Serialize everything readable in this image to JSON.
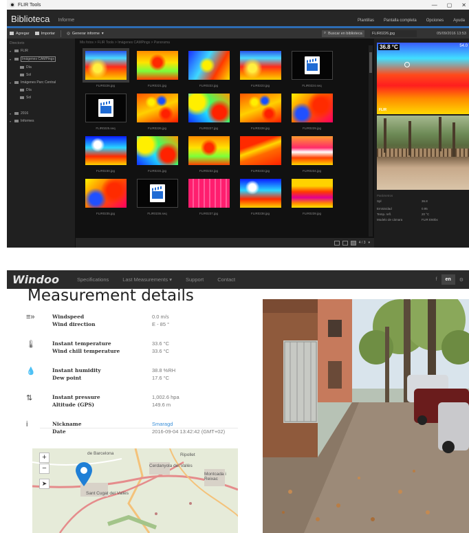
{
  "flir": {
    "window_title": "FLIR Tools",
    "header": {
      "title": "Biblioteca",
      "tab": "Informe",
      "menu": [
        "Plantillas",
        "Pantalla completa",
        "Opciones",
        "Ayuda"
      ]
    },
    "toolbar": {
      "add": "Agregar",
      "import": "Importar",
      "generate": "Generar informe",
      "search_placeholder": "Buscar en biblioteca",
      "filename": "FLIR0226.jpg",
      "filedate": "05/09/2016 13:53"
    },
    "sidebar": {
      "header": "Directorio",
      "items": [
        {
          "label": "FLIR",
          "level": 1
        },
        {
          "label": "Imágenes CAMPings",
          "level": 1,
          "selected": true
        },
        {
          "label": "Día",
          "level": 2
        },
        {
          "label": "Sol",
          "level": 2
        },
        {
          "label": "Imágenes Parc Central",
          "level": 1
        },
        {
          "label": "Día",
          "level": 2
        },
        {
          "label": "Sol",
          "level": 2
        }
      ],
      "items2": [
        {
          "label": "2016",
          "level": 1
        },
        {
          "label": "Informes",
          "level": 1
        }
      ]
    },
    "crumb": "Mis fotos > FLIR Tools > Imágenes CAMPings > Panorama",
    "thumbnails": [
      {
        "cap": "FLIR0226.jpg",
        "kind": "th-red",
        "sel": true
      },
      {
        "cap": "FLIR0221.jpg",
        "kind": "th-field"
      },
      {
        "cap": "FLIR0222.jpg",
        "kind": "th-blue"
      },
      {
        "cap": "FLIR0223.jpg",
        "kind": "th-red"
      },
      {
        "cap": "FLIR0224.seq",
        "kind": "vid"
      },
      {
        "cap": "FLIR0225.seq",
        "kind": "vid"
      },
      {
        "cap": "FLIR0226.jpg",
        "kind": "th-speck"
      },
      {
        "cap": "FLIR0227.jpg",
        "kind": "th-mix"
      },
      {
        "cap": "FLIR0228.jpg",
        "kind": "th-speck"
      },
      {
        "cap": "FLIR0229.jpg",
        "kind": "th-hot"
      },
      {
        "cap": "FLIR0230.jpg",
        "kind": "th-blue2"
      },
      {
        "cap": "FLIR0231.jpg",
        "kind": "th-mix"
      },
      {
        "cap": "FLIR0232.jpg",
        "kind": "th-field"
      },
      {
        "cap": "FLIR0233.jpg",
        "kind": "th-slope"
      },
      {
        "cap": "FLIR0234.jpg",
        "kind": "th-stripe"
      },
      {
        "cap": "FLIR0235.jpg",
        "kind": "th-hot"
      },
      {
        "cap": "FLIR0236.seq",
        "kind": "vid"
      },
      {
        "cap": "FLIR0237.jpg",
        "kind": "th-pink"
      },
      {
        "cap": "FLIR0238.jpg",
        "kind": "th-blue2"
      },
      {
        "cap": "FLIR0239.jpg",
        "kind": "th-street"
      }
    ],
    "status": {
      "count": "4 / 3"
    },
    "preview": {
      "temp": "36.8 °C",
      "temp2": "54.0",
      "brand": "FLIR"
    },
    "props": {
      "header": "Parámetros",
      "rows": [
        [
          "Spl",
          "36.8"
        ],
        [
          "",
          ""
        ],
        [
          "Emisividad",
          "0.95"
        ],
        [
          "Temp. refl.",
          "20 °C"
        ],
        [
          "Modelo de cámara",
          "FLIR E60bx"
        ]
      ]
    }
  },
  "windoo": {
    "brand": "Windoo",
    "nav": [
      "Specifications",
      "Last Measurements ▾",
      "Support",
      "Contact"
    ],
    "lang": "en",
    "title": "Measurement details",
    "rows": [
      {
        "icon": "≡»",
        "labels": [
          "Windspeed",
          "Wind direction"
        ],
        "values": [
          "0.0 m/s",
          "E - 85 °"
        ]
      },
      {
        "icon": "🌡",
        "labels": [
          "Instant temperature",
          "Wind chill temperature"
        ],
        "values": [
          "33.6 °C",
          "33.6 °C"
        ]
      },
      {
        "icon": "💧",
        "labels": [
          "Instant humidity",
          "Dew point"
        ],
        "values": [
          "38.8 %RH",
          "17.6 °C"
        ]
      },
      {
        "icon": "⇅",
        "labels": [
          "Instant pressure",
          "Altitude (GPS)"
        ],
        "values": [
          "1,002.6 hpa",
          "149.6 m"
        ]
      },
      {
        "icon": "i",
        "labels": [
          "Nickname",
          "Date"
        ],
        "values": [
          "Smaragd",
          "2016-09-04 13:42:42 (GMT+02)"
        ],
        "link": true
      }
    ],
    "map": {
      "labels": [
        "Sant Cugat del Vallès",
        "Cerdanyola del Vallès",
        "Ripollet",
        "Montcada i Reixac",
        "de Barcelona"
      ],
      "zoom_in": "+",
      "zoom_out": "−"
    }
  }
}
